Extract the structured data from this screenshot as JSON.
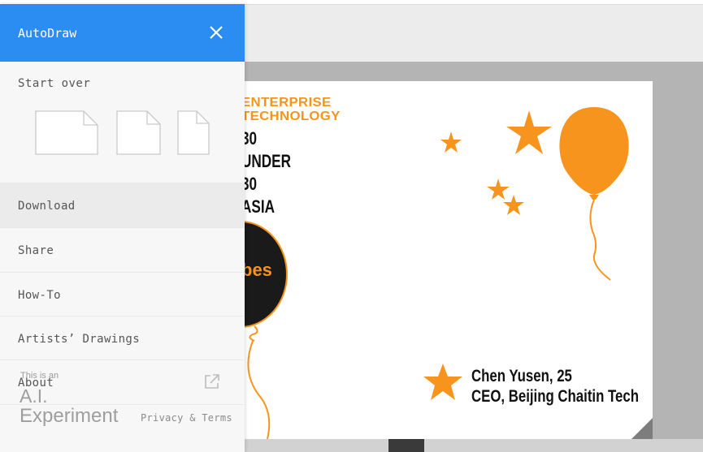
{
  "colors": {
    "accent": "#2b8cf2",
    "poster_orange": "#f7941d",
    "sidebar_bg": "#f7f7f7"
  },
  "sidebar": {
    "title": "AutoDraw",
    "close_icon": "close-icon",
    "start_over": "Start over",
    "paper_sizes": [
      "landscape",
      "square",
      "portrait"
    ],
    "menu": [
      {
        "label": "Download",
        "active": true
      },
      {
        "label": "Share"
      },
      {
        "label": "How-To"
      },
      {
        "label": "Artists’ Drawings"
      },
      {
        "label": "About",
        "icon": "external-link-icon"
      }
    ],
    "experiment": {
      "small": "This is an",
      "ai": "A.I.",
      "word": "Experiment"
    },
    "privacy": "Privacy & Terms"
  },
  "poster": {
    "line1": "ENTERPRISE",
    "line2": "TECHNOLOGY",
    "line3": "30",
    "line4": "UNDER",
    "line5": "30",
    "line6": "ASIA",
    "brand": "bes",
    "name": "Chen Yusen, 25",
    "title": "CEO, Beijing Chaitin Tech"
  }
}
